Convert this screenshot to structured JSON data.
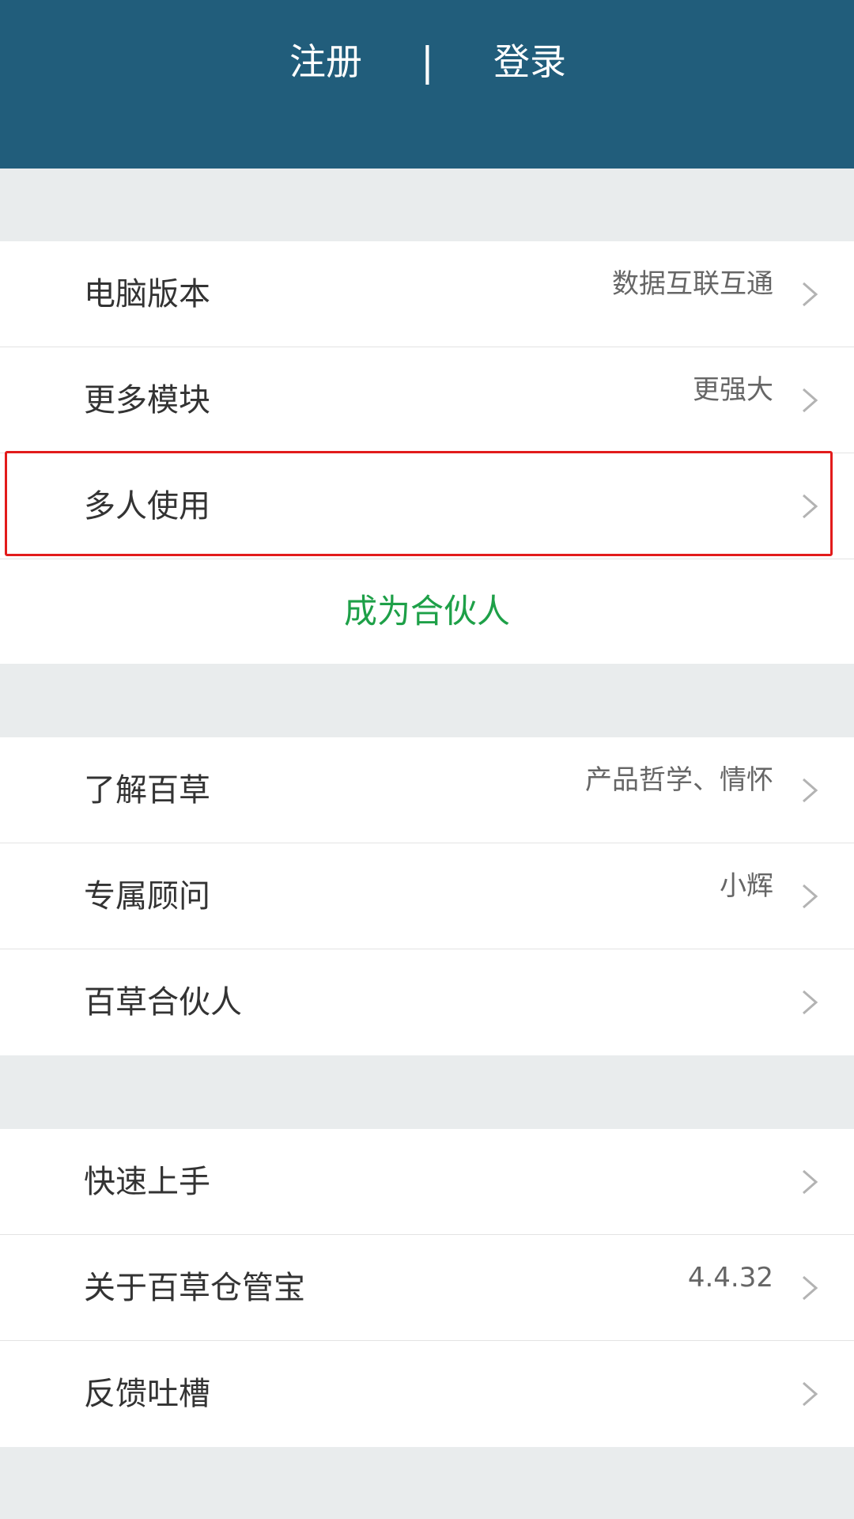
{
  "header": {
    "register_label": "注册",
    "divider": "|",
    "login_label": "登录",
    "background_color": "#215d7b"
  },
  "group1": {
    "items": [
      {
        "label": "电脑版本",
        "value": "数据互联互通"
      },
      {
        "label": "更多模块",
        "value": "更强大"
      },
      {
        "label": "多人使用",
        "value": ""
      }
    ],
    "partner_button": "成为合伙人",
    "partner_color": "#1ea048"
  },
  "group2": {
    "items": [
      {
        "label": "了解百草",
        "value": "产品哲学、情怀"
      },
      {
        "label": "专属顾问",
        "value": "小辉"
      },
      {
        "label": "百草合伙人",
        "value": ""
      }
    ]
  },
  "group3": {
    "items": [
      {
        "label": "快速上手",
        "value": ""
      },
      {
        "label": "关于百草仓管宝",
        "value": "4.4.32"
      },
      {
        "label": "反馈吐槽",
        "value": ""
      }
    ]
  },
  "icons": {
    "chevron": "chevron-right-icon"
  },
  "highlight_color": "#e21b1b"
}
